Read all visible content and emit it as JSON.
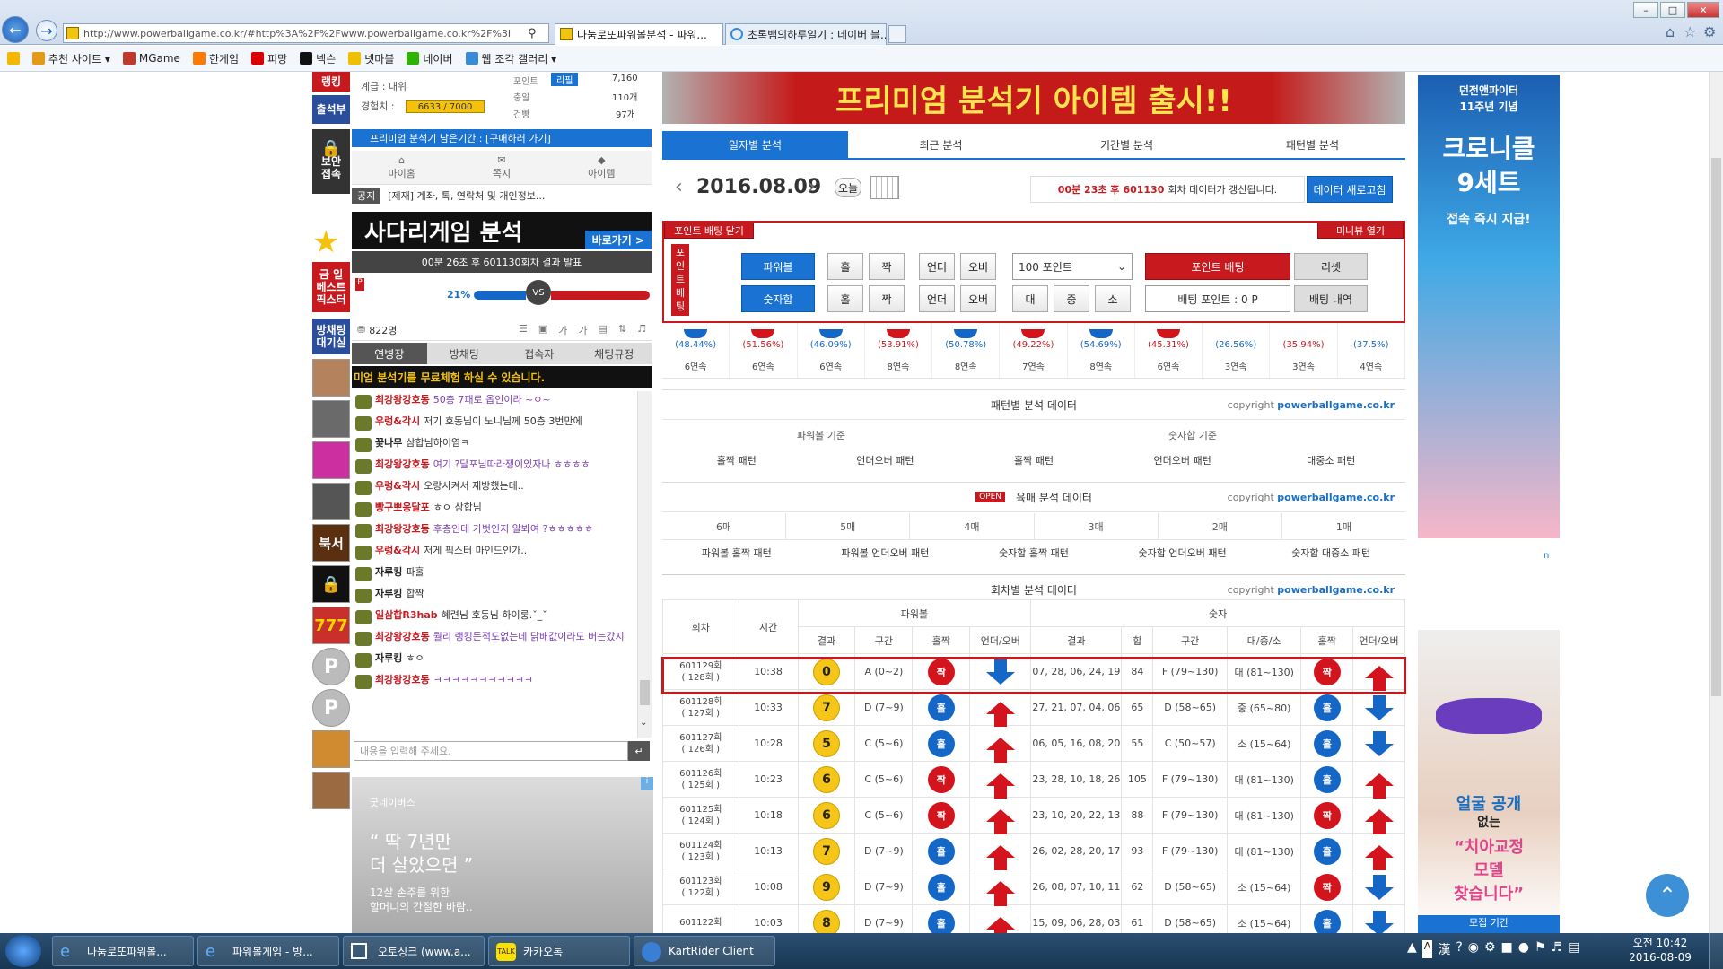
{
  "browser": {
    "url": "http://www.powerballgame.co.kr/#http%3A%2F%2Fwww.powerballgame.co.kr%2F%3I",
    "tabs": [
      {
        "label": "나눔로또파워볼분석 - 파워..."
      },
      {
        "label": "초록뱀의하루일기 : 네이버 블..."
      }
    ],
    "favorites": [
      "추천 사이트 ▾",
      "MGame",
      "한게임",
      "피망",
      "넥슨",
      "넷마블",
      "네이버",
      "웹 조각 갤러리 ▾"
    ]
  },
  "profile": {
    "rank_label": "랭킹",
    "grade_label": "계급 : 대위",
    "exp_label": "경험치 :",
    "exp_value": "6633 / 7000",
    "point_label": "포인트",
    "point_badge": "리필",
    "point_value": "7,160",
    "coin_label": "충알",
    "coin_value": "110개",
    "gun_label": "건빵",
    "gun_value": "97개",
    "attendance": "출석부",
    "security": "보안\n접속",
    "premium_notice": "프리미엄 분석기 남은기간 : [구매하러 가기]",
    "menu": [
      "마이홈",
      "쪽지",
      "아이템"
    ],
    "notice_tag": "공지",
    "notice_text": "[제재] 계좌, 톡, 연락처 및 개인정보..."
  },
  "ladder": {
    "banner": "사다리게임 분석",
    "go": "바로가기 >",
    "status": "00분 26초 후 601130회차 결과 발표",
    "left_pct": "21%",
    "vs": "VS",
    "right_pct": "79%",
    "left_ratio": 0.21
  },
  "sidebar_left": {
    "best_pick": "금 일\n베스트\n픽스터",
    "waiting": "방채팅\n대기실"
  },
  "chat": {
    "count": "822명",
    "tabs": [
      "연병장",
      "방채팅",
      "접속자",
      "채팅규정"
    ],
    "marquee": "미엄 분석기를 무료체험 하실 수 있습니다.",
    "messages": [
      {
        "user": "최강왕강호동",
        "text": "50층 7패로 옵인이라 ~ㅇ~",
        "ucolor": "#c8191f",
        "tcolor": "#7b3fb0"
      },
      {
        "user": "우렁&각시",
        "text": "저기 호동님이 노니님께 50층 3번만에",
        "ucolor": "#c8191f",
        "tcolor": "#333"
      },
      {
        "user": "꽃나무",
        "text": "삼합님하이염ㅋ",
        "ucolor": "#222",
        "tcolor": "#333"
      },
      {
        "user": "최강왕강호동",
        "text": "여기 ?달포님따라쟁이있자나 ㅎㅎㅎㅎ",
        "ucolor": "#c8191f",
        "tcolor": "#7b3fb0"
      },
      {
        "user": "우렁&각시",
        "text": "오랑시켜서 재방했는데..",
        "ucolor": "#c8191f",
        "tcolor": "#333"
      },
      {
        "user": "빵구뽀옹달포",
        "text": "ㅎㅇ 삼합님",
        "ucolor": "#c8191f",
        "tcolor": "#333"
      },
      {
        "user": "최강왕강호동",
        "text": "후층인데 가벗인지 알봐여 ?ㅎㅎㅎㅎㅎ",
        "ucolor": "#c8191f",
        "tcolor": "#7b3fb0"
      },
      {
        "user": "우렁&각시",
        "text": "저게 픽스터 마인드인가..",
        "ucolor": "#c8191f",
        "tcolor": "#333"
      },
      {
        "user": "자루킹",
        "text": "파홀",
        "ucolor": "#222",
        "tcolor": "#333"
      },
      {
        "user": "자루킹",
        "text": "합짝",
        "ucolor": "#222",
        "tcolor": "#333"
      },
      {
        "user": "일삼합R3hab",
        "text": "혜련님 호동님 하이룽.ˇ_ˇ",
        "ucolor": "#c8191f",
        "tcolor": "#333"
      },
      {
        "user": "최강왕강호동",
        "text": "뭘리 랭킹든적도없는데 닭배값이라도 버는갔지",
        "ucolor": "#c8191f",
        "tcolor": "#7b3fb0"
      },
      {
        "user": "자루킹",
        "text": "ㅎㅇ",
        "ucolor": "#222",
        "tcolor": "#333"
      },
      {
        "user": "최강왕강호동",
        "text": "ㅋㅋㅋㅋㅋㅋㅋㅋㅋㅋㅋ",
        "ucolor": "#c8191f",
        "tcolor": "#7b3fb0"
      }
    ],
    "input_placeholder": "내용을 입력해 주세요."
  },
  "ad_left": {
    "brand": "굿네이버스",
    "line1": "“ 딱 7년만",
    "line2": "더 살았으면 ”",
    "line3": "12살 손주를 위한",
    "line4": "할머니의 간절한 바람.."
  },
  "main": {
    "banner_text": "프리미엄 분석기 아이템 출시!!",
    "tabs": [
      "일자별 분석",
      "최근 분석",
      "기간별 분석",
      "패턴별 분석"
    ],
    "date": "2016.08.09",
    "today_btn": "오늘",
    "update_prefix": "00분 23초 후",
    "update_round": "601130",
    "update_suffix": "회차 데이터가 갱신됩니다.",
    "refresh_btn": "데이터 새로고침",
    "bet_close": "포인트 배팅 닫기",
    "bet_side": "포\n인\n트\n배\n팅",
    "mini_open": "미니뷰 열기",
    "powerball_btn": "파워볼",
    "number_btn": "숫자합",
    "odd": "홀",
    "even": "짝",
    "under": "언더",
    "over": "오버",
    "big": "대",
    "mid": "중",
    "small": "소",
    "point_select": "100 포인트",
    "point_bet_btn": "포인트 배팅",
    "reset_btn": "리셋",
    "bet_point_label": "배팅 포인트 : 0 P",
    "bet_history_btn": "배팅 내역",
    "streak_pcts": [
      "(48.44%)",
      "(51.56%)",
      "(46.09%)",
      "(53.91%)",
      "(50.78%)",
      "(49.22%)",
      "(54.69%)",
      "(45.31%)",
      "(26.56%)",
      "(35.94%)",
      "(37.5%)"
    ],
    "streaks": [
      "6연속",
      "6연속",
      "6연속",
      "8연속",
      "8연속",
      "7연속",
      "8연속",
      "6연속",
      "3연속",
      "3연속",
      "4연속"
    ],
    "pattern_title": "패턴별 분석 데이터",
    "copyright_prefix": "copyright",
    "copyright_site": "powerballgame.co.kr",
    "pattern_groups": [
      "파워볼 기준",
      "숫자합 기준"
    ],
    "pattern_items": [
      "홀짝 패턴",
      "언더오버 패턴",
      "홀짝 패턴",
      "언더오버 패턴",
      "대중소 패턴"
    ],
    "open_badge": "OPEN",
    "six_title": "육매 분석 데이터",
    "six_cols": [
      "6매",
      "5매",
      "4매",
      "3매",
      "2매",
      "1매"
    ],
    "six_items": [
      "파워볼 홀짝 패턴",
      "파워볼 언더오버 패턴",
      "숫자합 홀짝 패턴",
      "숫자합 언더오버 패턴",
      "숫자합 대중소 패턴"
    ],
    "round_title": "회차별 분석 데이터",
    "table_head": {
      "round": "회차",
      "time": "시간",
      "pb": "파워볼",
      "num": "숫자",
      "result": "결과",
      "section": "구간",
      "oddeven": "홀짝",
      "uo": "언더/오버",
      "sum": "합",
      "bms": "대/중/소"
    },
    "rows": [
      {
        "round": "601129회",
        "sub": "( 128회 )",
        "time": "10:38",
        "pb": "0",
        "pbsec": "A (0~2)",
        "pboe": "짝",
        "pbuo": "down",
        "nums": "07, 28, 06, 24, 19",
        "sum": "84",
        "sec": "F (79~130)",
        "bms": "대 (81~130)",
        "oe": "짝",
        "uo": "up"
      },
      {
        "round": "601128회",
        "sub": "( 127회 )",
        "time": "10:33",
        "pb": "7",
        "pbsec": "D (7~9)",
        "pboe": "홀",
        "pbuo": "up",
        "nums": "27, 21, 07, 04, 06",
        "sum": "65",
        "sec": "D (58~65)",
        "bms": "중 (65~80)",
        "oe": "홀",
        "uo": "down"
      },
      {
        "round": "601127회",
        "sub": "( 126회 )",
        "time": "10:28",
        "pb": "5",
        "pbsec": "C (5~6)",
        "pboe": "홀",
        "pbuo": "up",
        "nums": "06, 05, 16, 08, 20",
        "sum": "55",
        "sec": "C (50~57)",
        "bms": "소 (15~64)",
        "oe": "홀",
        "uo": "down"
      },
      {
        "round": "601126회",
        "sub": "( 125회 )",
        "time": "10:23",
        "pb": "6",
        "pbsec": "C (5~6)",
        "pboe": "짝",
        "pbuo": "up",
        "nums": "23, 28, 10, 18, 26",
        "sum": "105",
        "sec": "F (79~130)",
        "bms": "대 (81~130)",
        "oe": "홀",
        "uo": "up"
      },
      {
        "round": "601125회",
        "sub": "( 124회 )",
        "time": "10:18",
        "pb": "6",
        "pbsec": "C (5~6)",
        "pboe": "짝",
        "pbuo": "up",
        "nums": "23, 10, 20, 22, 13",
        "sum": "88",
        "sec": "F (79~130)",
        "bms": "대 (81~130)",
        "oe": "짝",
        "uo": "up"
      },
      {
        "round": "601124회",
        "sub": "( 123회 )",
        "time": "10:13",
        "pb": "7",
        "pbsec": "D (7~9)",
        "pboe": "홀",
        "pbuo": "up",
        "nums": "26, 02, 28, 20, 17",
        "sum": "93",
        "sec": "F (79~130)",
        "bms": "대 (81~130)",
        "oe": "홀",
        "uo": "up"
      },
      {
        "round": "601123회",
        "sub": "( 122회 )",
        "time": "10:08",
        "pb": "9",
        "pbsec": "D (7~9)",
        "pboe": "홀",
        "pbuo": "up",
        "nums": "26, 08, 07, 10, 11",
        "sum": "62",
        "sec": "D (58~65)",
        "bms": "소 (15~64)",
        "oe": "짝",
        "uo": "down"
      },
      {
        "round": "601122회",
        "sub": "",
        "time": "10:03",
        "pb": "8",
        "pbsec": "D (7~9)",
        "pboe": "홀",
        "pbuo": "up",
        "nums": "15, 09, 06, 28, 03",
        "sum": "61",
        "sec": "D (58~65)",
        "bms": "소 (15~64)",
        "oe": "홀",
        "uo": "down"
      }
    ]
  },
  "ads_right": {
    "top1": "던전앤파이터",
    "top2": "11주년 기념",
    "top3": "크로니클",
    "top4": "9세트",
    "top5": "접속 즉시 지급!",
    "bot1": "얼굴 공개",
    "bot2": "없는",
    "bot3": "“치아교정",
    "bot4": "모델",
    "bot5": "찾습니다”",
    "bot6": "모집 기간"
  },
  "taskbar": {
    "items": [
      "나눔로또파워볼...",
      "파워볼게임 - 방...",
      "오토싱크 (www.a...",
      "카카오톡",
      "KartRider Client"
    ],
    "time": "오전 10:42",
    "date": "2016-08-09"
  },
  "colors": {
    "accent": "#1a73d2",
    "red": "#c8191f",
    "navy": "#2b4e9c"
  }
}
